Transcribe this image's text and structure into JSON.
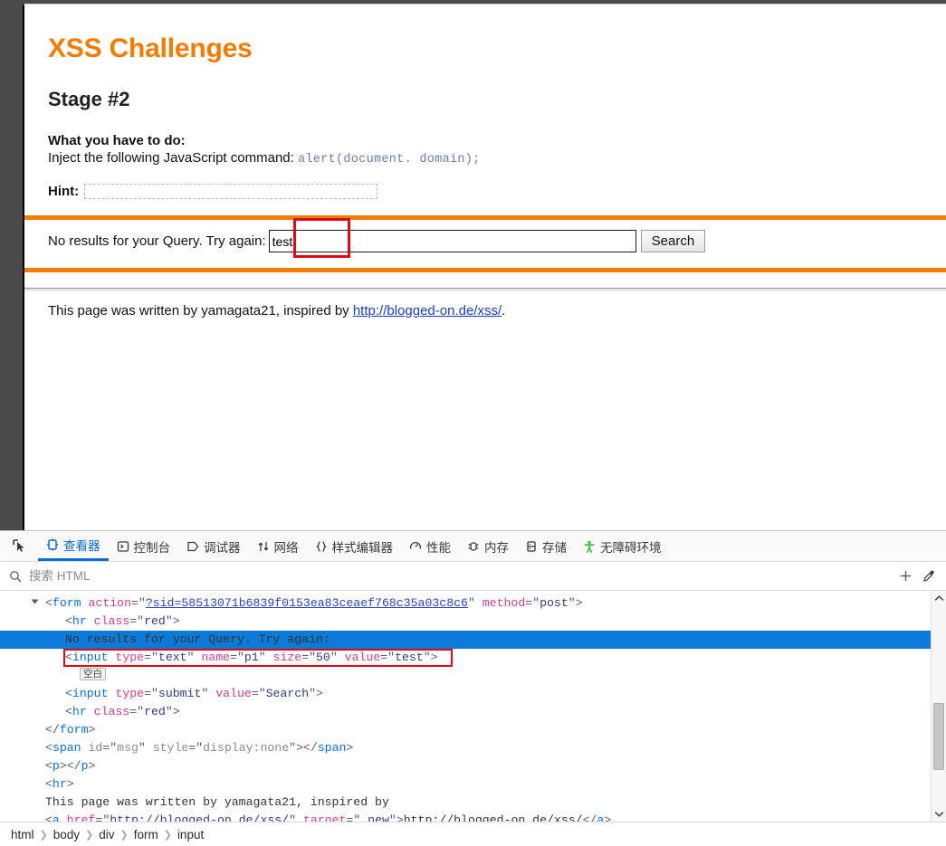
{
  "page": {
    "site_title": "XSS Challenges",
    "stage_title": "Stage #2",
    "todo_heading": "What you have to do:",
    "todo_text": "Inject the following JavaScript command:",
    "todo_code": "alert(document. domain);",
    "hint_label": "Hint:",
    "query_text": "No results for your Query. Try again:",
    "query_value": "test",
    "search_button": "Search",
    "footer_prefix": "This page was written by yamagata21, inspired by ",
    "footer_link": "http://blogged-on.de/xss/",
    "footer_suffix": ".",
    "accent_color": "#f07d00",
    "title_color": "#f57c00",
    "highlight_color": "#e30613"
  },
  "devtools": {
    "picker_icon": "element-picker-icon",
    "tabs": [
      {
        "label": "查看器",
        "icon": "inspector-icon",
        "active": true
      },
      {
        "label": "控制台",
        "icon": "console-icon",
        "active": false
      },
      {
        "label": "调试器",
        "icon": "debugger-icon",
        "active": false
      },
      {
        "label": "网络",
        "icon": "network-icon",
        "active": false
      },
      {
        "label": "样式编辑器",
        "icon": "style-editor-icon",
        "active": false
      },
      {
        "label": "性能",
        "icon": "performance-icon",
        "active": false
      },
      {
        "label": "内存",
        "icon": "memory-icon",
        "active": false
      },
      {
        "label": "存储",
        "icon": "storage-icon",
        "active": false
      },
      {
        "label": "无障碍环境",
        "icon": "accessibility-icon",
        "active": false
      }
    ],
    "search": {
      "placeholder": "搜索 HTML",
      "value": "",
      "icon": "search-icon",
      "add_icon": "plus-icon",
      "pick_icon": "eyedropper-icon"
    },
    "tree": {
      "form_tag": "form",
      "form_attr_action": "action",
      "form_action_value": "?sid=58513071b6839f0153ea83ceaef768c35a03c8c6",
      "form_attr_method": "method",
      "form_method_value": "post",
      "hr_tag": "hr",
      "hr_attr_class": "class",
      "hr_class_value": "red",
      "selected_text": "No results for your Query. Try again:",
      "input_line": "<input type=\"text\" name=\"p1\" size=\"50\" value=\"test\">",
      "whitespace_badge": "空白",
      "submit_line": "<input type=\"submit\" value=\"Search\">",
      "form_close": "</form>",
      "span_line": "<span id=\"msg\" style=\"display:none\"></span>",
      "p_line": "<p></p>",
      "hr_plain_line": "<hr>",
      "text_line": "This page was written by yamagata21, inspired by",
      "anchor_line": "<a href=\"http://blogged-on.de/xss/\" target=\"_new\">http://blogged-on.de/xss/</a>"
    },
    "breadcrumb": [
      "html",
      "body",
      "div",
      "form",
      "input"
    ],
    "scroll": {
      "up_icon": "chevron-up-icon",
      "down_icon": "chevron-down-icon"
    }
  }
}
